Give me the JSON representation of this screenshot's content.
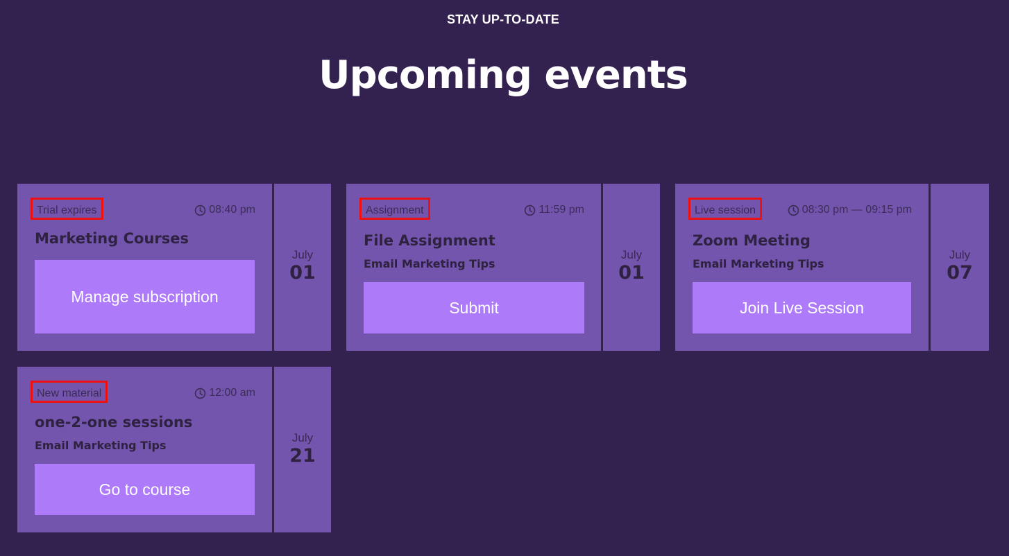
{
  "header": {
    "eyebrow": "STAY UP-TO-DATE",
    "title": "Upcoming events"
  },
  "events": [
    {
      "tag": "Trial expires",
      "time": "08:40 pm",
      "title": "Marketing Courses",
      "subtitle": "",
      "button": "Manage subscription",
      "month": "July",
      "day": "01"
    },
    {
      "tag": "Assignment",
      "time": "11:59 pm",
      "title": "File Assignment",
      "subtitle": "Email Marketing Tips",
      "button": "Submit",
      "month": "July",
      "day": "01"
    },
    {
      "tag": "Live session",
      "time": "08:30 pm — 09:15 pm",
      "title": "Zoom Meeting",
      "subtitle": "Email Marketing Tips",
      "button": "Join Live Session",
      "month": "July",
      "day": "07"
    },
    {
      "tag": "New material",
      "time": "12:00 am",
      "title": "one-2-one sessions",
      "subtitle": "Email Marketing Tips",
      "button": "Go to course",
      "month": "July",
      "day": "21"
    }
  ],
  "colors": {
    "background": "#332250",
    "card": "#7355ae",
    "button": "#ad7bfa",
    "highlight_border": "#ee1111"
  },
  "icons": {
    "time": "clock-icon"
  }
}
